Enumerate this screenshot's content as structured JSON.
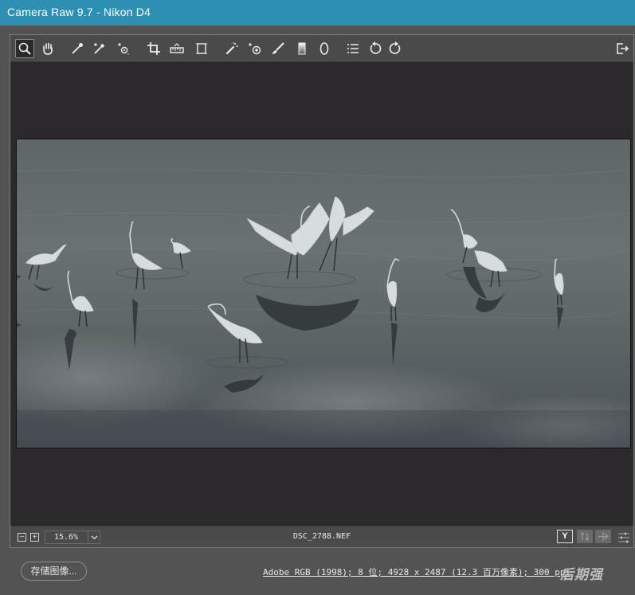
{
  "window": {
    "title": "Camera Raw 9.7  -  Nikon D4"
  },
  "toolbar": {
    "tools": [
      {
        "name": "zoom-tool",
        "icon": "magnifier-icon",
        "active": true
      },
      {
        "name": "hand-tool",
        "icon": "hand-icon"
      },
      {
        "name": "white-balance-tool",
        "icon": "eyedropper-icon"
      },
      {
        "name": "color-sampler-tool",
        "icon": "eyedropper-plus-icon"
      },
      {
        "name": "targeted-adjustment-tool",
        "icon": "target-adjust-icon"
      },
      {
        "name": "crop-tool",
        "icon": "crop-icon"
      },
      {
        "name": "straighten-tool",
        "icon": "level-icon"
      },
      {
        "name": "transform-tool",
        "icon": "transform-icon"
      },
      {
        "name": "spot-removal-tool",
        "icon": "brush-heal-icon"
      },
      {
        "name": "red-eye-tool",
        "icon": "eye-plus-icon"
      },
      {
        "name": "adjustment-brush-tool",
        "icon": "brush-icon"
      },
      {
        "name": "graduated-filter-tool",
        "icon": "gradient-icon"
      },
      {
        "name": "radial-filter-tool",
        "icon": "ellipse-icon"
      },
      {
        "name": "preferences-button",
        "icon": "list-icon"
      },
      {
        "name": "rotate-left-button",
        "icon": "rotate-ccw-icon"
      },
      {
        "name": "rotate-right-button",
        "icon": "rotate-cw-icon"
      }
    ],
    "fullscreen_icon": "export-icon"
  },
  "status": {
    "zoom_out": "−",
    "zoom_in": "+",
    "zoom_value": "15.6%",
    "filename": "DSC_2788.NEF",
    "y_button": "Y"
  },
  "bottom": {
    "save_button": "存储图像...",
    "info": "Adobe RGB (1998); 8 位; 4928 x 2487 (12.3 百万像素); 300 ppi",
    "watermark": "后期强"
  },
  "colors": {
    "titlebar": "#2d8fb3",
    "panel": "#4a4a4a",
    "canvas": "#2b292c"
  }
}
